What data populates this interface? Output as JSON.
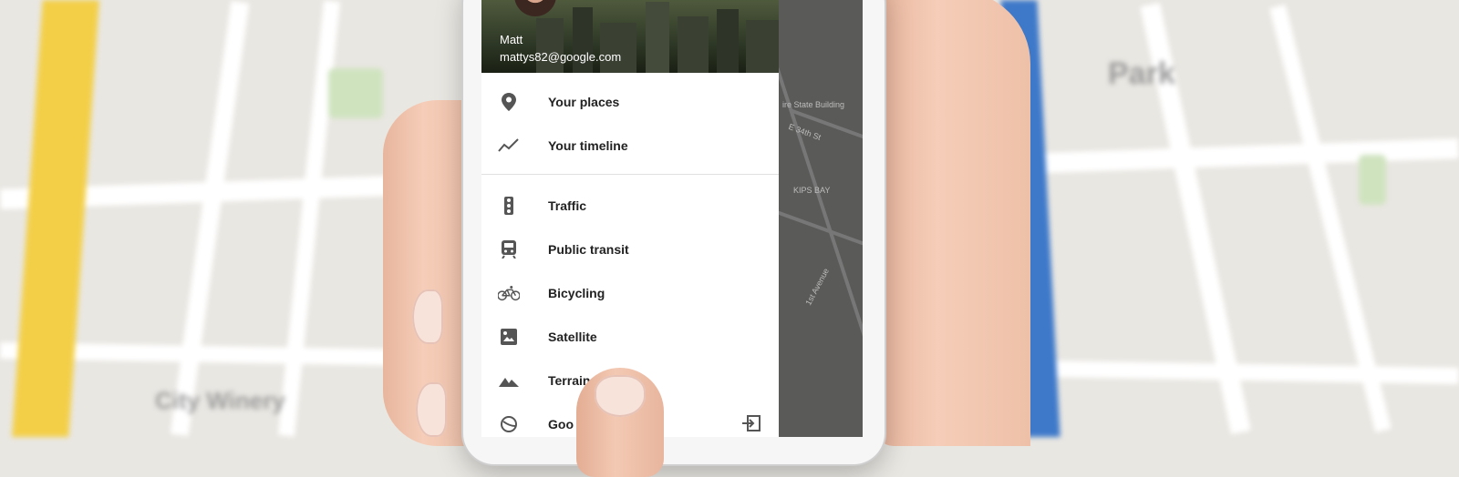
{
  "drawer": {
    "user_name": "Matt",
    "user_email": "mattys82@google.com",
    "items": [
      {
        "label": "Your places",
        "icon": "map-pin-icon"
      },
      {
        "label": "Your timeline",
        "icon": "timeline-icon"
      },
      {
        "label": "Traffic",
        "icon": "traffic-light-icon"
      },
      {
        "label": "Public transit",
        "icon": "train-icon"
      },
      {
        "label": "Bicycling",
        "icon": "bicycle-icon"
      },
      {
        "label": "Satellite",
        "icon": "satellite-icon"
      },
      {
        "label": "Terrain",
        "icon": "terrain-icon"
      },
      {
        "label": "Goo",
        "icon": "google-earth-icon"
      }
    ]
  },
  "map": {
    "labels": [
      "ire State Building",
      "E 34th St",
      "KIPS BAY",
      "1st Avenue"
    ]
  },
  "background": {
    "labels": [
      "Park",
      "City Winery"
    ]
  },
  "colors": {
    "drawer_bg": "#ffffff",
    "text": "#222222",
    "icon": "#555555"
  }
}
